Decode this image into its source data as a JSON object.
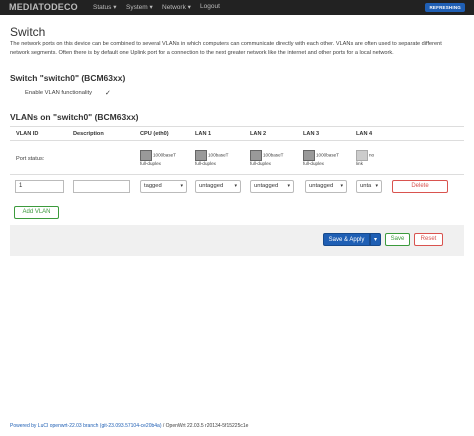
{
  "nav": {
    "brand": "MEDIATODECO",
    "menu": [
      {
        "label": "Status"
      },
      {
        "label": "System"
      },
      {
        "label": "Network"
      },
      {
        "label": "Logout"
      }
    ],
    "refresh_label": "REFRESHING"
  },
  "page": {
    "title": "Switch",
    "description": "The network ports on this device can be combined to several VLANs in which computers can communicate directly with each other. VLANs are often used to separate different network segments. Often there is by default one Uplink port for a connection to the next greater network like the internet and other ports for a local network."
  },
  "switch_section": {
    "heading": "Switch \"switch0\" (BCM63xx)",
    "vlan_enable_label": "Enable VLAN functionality",
    "vlan_enable_checked": true
  },
  "vlans_section": {
    "heading": "VLANs on \"switch0\" (BCM63xx)",
    "columns": [
      "VLAN ID",
      "Description",
      "CPU (eth0)",
      "LAN 1",
      "LAN 2",
      "LAN 3",
      "LAN 4"
    ],
    "port_status_label": "Port status:",
    "ports": [
      {
        "line1": "1000baseT",
        "line2": "full-duplex",
        "link": true
      },
      {
        "line1": "100baseT",
        "line2": "full-duplex",
        "link": true
      },
      {
        "line1": "100baseT",
        "line2": "full-duplex",
        "link": true
      },
      {
        "line1": "1000baseT",
        "line2": "full-duplex",
        "link": true
      },
      {
        "line1": "no",
        "line2": "link",
        "link": false
      }
    ],
    "row": {
      "vlan_id": "1",
      "description": "",
      "cpu": "tagged",
      "lan1": "untagged",
      "lan2": "untagged",
      "lan3": "untagged",
      "lan4": "unta"
    },
    "delete_label": "Delete",
    "add_label": "Add VLAN"
  },
  "actions": {
    "save_apply": "Save & Apply",
    "save": "Save",
    "reset": "Reset"
  },
  "footer": {
    "link_text": "Powered by LuCI openwrt-22.03 branch (git-23.093.57104-ce20b4a)",
    "version_text": " / OpenWrt 22.03.5 r20134-5f15225c1e"
  },
  "colors": {
    "navbar": "#222222",
    "primary": "#1f5fb4",
    "positive": "#3c9a3c",
    "negative": "#d9534f"
  }
}
